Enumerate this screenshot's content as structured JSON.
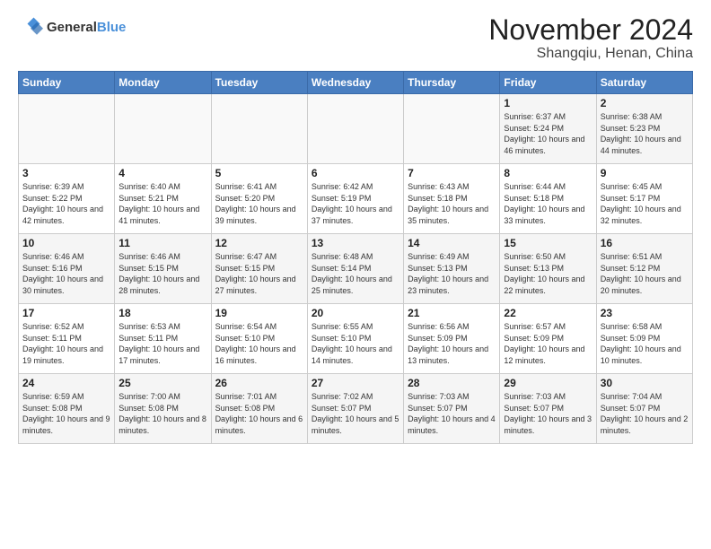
{
  "header": {
    "logo_line1": "General",
    "logo_line2": "Blue",
    "month": "November 2024",
    "location": "Shangqiu, Henan, China"
  },
  "weekdays": [
    "Sunday",
    "Monday",
    "Tuesday",
    "Wednesday",
    "Thursday",
    "Friday",
    "Saturday"
  ],
  "weeks": [
    [
      {
        "day": "",
        "info": ""
      },
      {
        "day": "",
        "info": ""
      },
      {
        "day": "",
        "info": ""
      },
      {
        "day": "",
        "info": ""
      },
      {
        "day": "",
        "info": ""
      },
      {
        "day": "1",
        "info": "Sunrise: 6:37 AM\nSunset: 5:24 PM\nDaylight: 10 hours and 46 minutes."
      },
      {
        "day": "2",
        "info": "Sunrise: 6:38 AM\nSunset: 5:23 PM\nDaylight: 10 hours and 44 minutes."
      }
    ],
    [
      {
        "day": "3",
        "info": "Sunrise: 6:39 AM\nSunset: 5:22 PM\nDaylight: 10 hours and 42 minutes."
      },
      {
        "day": "4",
        "info": "Sunrise: 6:40 AM\nSunset: 5:21 PM\nDaylight: 10 hours and 41 minutes."
      },
      {
        "day": "5",
        "info": "Sunrise: 6:41 AM\nSunset: 5:20 PM\nDaylight: 10 hours and 39 minutes."
      },
      {
        "day": "6",
        "info": "Sunrise: 6:42 AM\nSunset: 5:19 PM\nDaylight: 10 hours and 37 minutes."
      },
      {
        "day": "7",
        "info": "Sunrise: 6:43 AM\nSunset: 5:18 PM\nDaylight: 10 hours and 35 minutes."
      },
      {
        "day": "8",
        "info": "Sunrise: 6:44 AM\nSunset: 5:18 PM\nDaylight: 10 hours and 33 minutes."
      },
      {
        "day": "9",
        "info": "Sunrise: 6:45 AM\nSunset: 5:17 PM\nDaylight: 10 hours and 32 minutes."
      }
    ],
    [
      {
        "day": "10",
        "info": "Sunrise: 6:46 AM\nSunset: 5:16 PM\nDaylight: 10 hours and 30 minutes."
      },
      {
        "day": "11",
        "info": "Sunrise: 6:46 AM\nSunset: 5:15 PM\nDaylight: 10 hours and 28 minutes."
      },
      {
        "day": "12",
        "info": "Sunrise: 6:47 AM\nSunset: 5:15 PM\nDaylight: 10 hours and 27 minutes."
      },
      {
        "day": "13",
        "info": "Sunrise: 6:48 AM\nSunset: 5:14 PM\nDaylight: 10 hours and 25 minutes."
      },
      {
        "day": "14",
        "info": "Sunrise: 6:49 AM\nSunset: 5:13 PM\nDaylight: 10 hours and 23 minutes."
      },
      {
        "day": "15",
        "info": "Sunrise: 6:50 AM\nSunset: 5:13 PM\nDaylight: 10 hours and 22 minutes."
      },
      {
        "day": "16",
        "info": "Sunrise: 6:51 AM\nSunset: 5:12 PM\nDaylight: 10 hours and 20 minutes."
      }
    ],
    [
      {
        "day": "17",
        "info": "Sunrise: 6:52 AM\nSunset: 5:11 PM\nDaylight: 10 hours and 19 minutes."
      },
      {
        "day": "18",
        "info": "Sunrise: 6:53 AM\nSunset: 5:11 PM\nDaylight: 10 hours and 17 minutes."
      },
      {
        "day": "19",
        "info": "Sunrise: 6:54 AM\nSunset: 5:10 PM\nDaylight: 10 hours and 16 minutes."
      },
      {
        "day": "20",
        "info": "Sunrise: 6:55 AM\nSunset: 5:10 PM\nDaylight: 10 hours and 14 minutes."
      },
      {
        "day": "21",
        "info": "Sunrise: 6:56 AM\nSunset: 5:09 PM\nDaylight: 10 hours and 13 minutes."
      },
      {
        "day": "22",
        "info": "Sunrise: 6:57 AM\nSunset: 5:09 PM\nDaylight: 10 hours and 12 minutes."
      },
      {
        "day": "23",
        "info": "Sunrise: 6:58 AM\nSunset: 5:09 PM\nDaylight: 10 hours and 10 minutes."
      }
    ],
    [
      {
        "day": "24",
        "info": "Sunrise: 6:59 AM\nSunset: 5:08 PM\nDaylight: 10 hours and 9 minutes."
      },
      {
        "day": "25",
        "info": "Sunrise: 7:00 AM\nSunset: 5:08 PM\nDaylight: 10 hours and 8 minutes."
      },
      {
        "day": "26",
        "info": "Sunrise: 7:01 AM\nSunset: 5:08 PM\nDaylight: 10 hours and 6 minutes."
      },
      {
        "day": "27",
        "info": "Sunrise: 7:02 AM\nSunset: 5:07 PM\nDaylight: 10 hours and 5 minutes."
      },
      {
        "day": "28",
        "info": "Sunrise: 7:03 AM\nSunset: 5:07 PM\nDaylight: 10 hours and 4 minutes."
      },
      {
        "day": "29",
        "info": "Sunrise: 7:03 AM\nSunset: 5:07 PM\nDaylight: 10 hours and 3 minutes."
      },
      {
        "day": "30",
        "info": "Sunrise: 7:04 AM\nSunset: 5:07 PM\nDaylight: 10 hours and 2 minutes."
      }
    ]
  ]
}
